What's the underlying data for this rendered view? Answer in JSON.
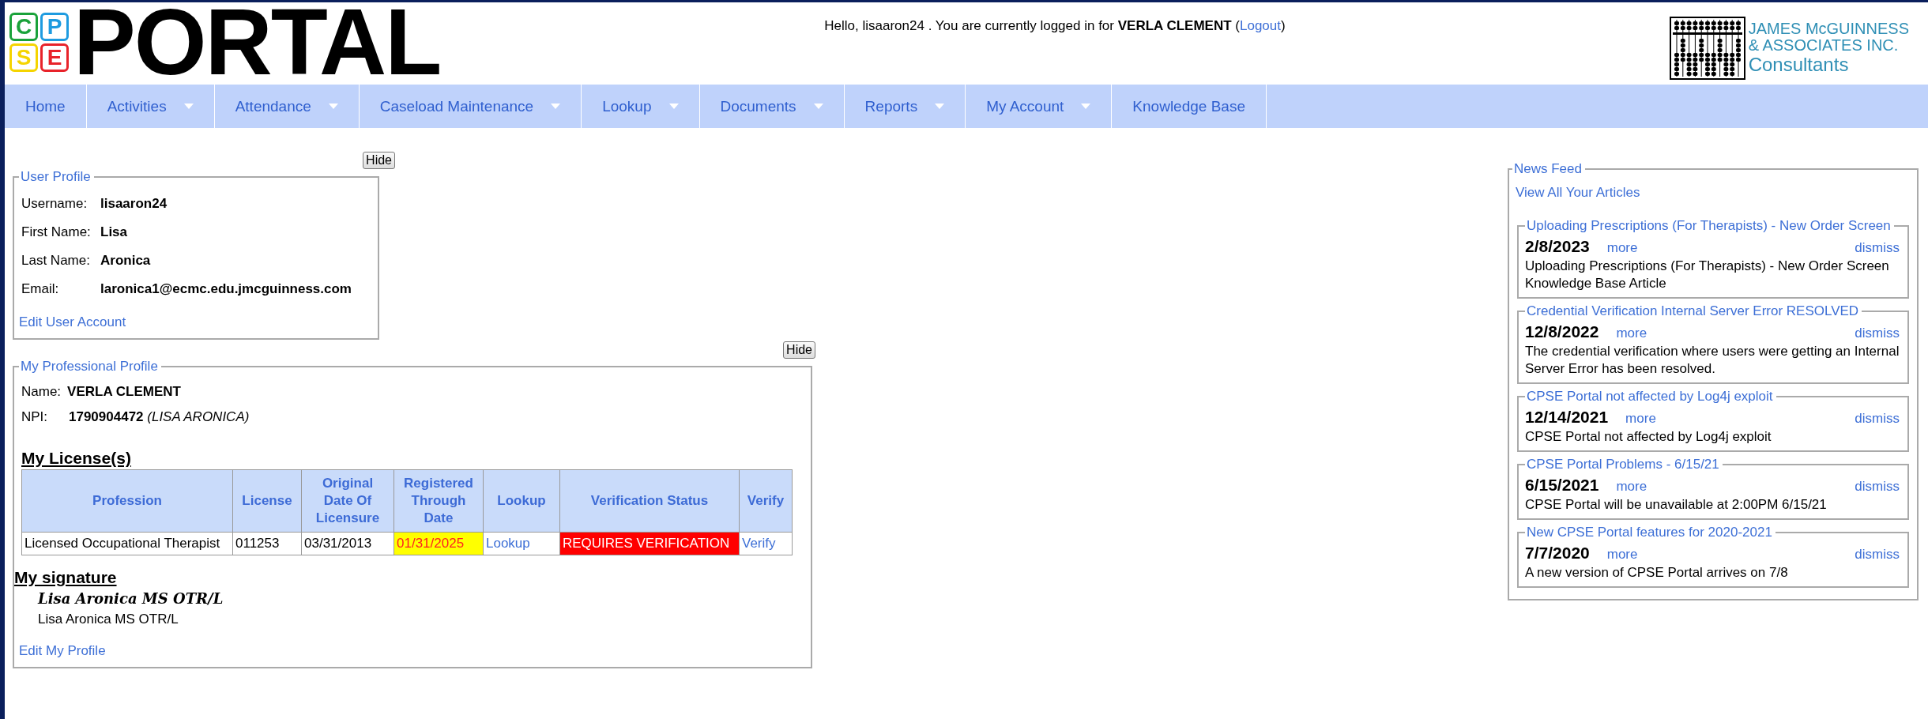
{
  "logo": {
    "letters": [
      {
        "char": "C",
        "color": "#1aa23a"
      },
      {
        "char": "P",
        "color": "#1e9be0"
      },
      {
        "char": "S",
        "color": "#f5d400"
      },
      {
        "char": "E",
        "color": "#e8232a"
      }
    ],
    "title": "PORTAL"
  },
  "header": {
    "greeting": "Hello, lisaaron24 . You are currently logged in for **VERLA CLEMENT** (",
    "logout": "Logout",
    "closing": ")",
    "company": [
      "JAMES McGUINNESS",
      "& ASSOCIATES INC.",
      "Consultants"
    ]
  },
  "nav": [
    {
      "label": "Home",
      "dropdown": false
    },
    {
      "label": "Activities",
      "dropdown": true
    },
    {
      "label": "Attendance",
      "dropdown": true
    },
    {
      "label": "Caseload Maintenance",
      "dropdown": true
    },
    {
      "label": "Lookup",
      "dropdown": true
    },
    {
      "label": "Documents",
      "dropdown": true
    },
    {
      "label": "Reports",
      "dropdown": true
    },
    {
      "label": "My Account",
      "dropdown": true
    },
    {
      "label": "Knowledge Base",
      "dropdown": false
    }
  ],
  "user_profile": {
    "hide": "Hide",
    "legend": "User Profile",
    "fields": [
      {
        "label": "Username:",
        "value": "lisaaron24"
      },
      {
        "label": "First Name:",
        "value": "Lisa"
      },
      {
        "label": "Last Name:",
        "value": "Aronica"
      },
      {
        "label": "Email:",
        "value": "laronica1@ecmc.edu.jmcguinness.com"
      }
    ],
    "edit_link": "Edit User Account"
  },
  "professional_profile": {
    "hide": "Hide",
    "legend": "My Professional Profile",
    "name_label": "Name:",
    "name": "VERLA CLEMENT",
    "npi_label": "NPI:",
    "npi": "1790904472",
    "npi_person": "(LISA ARONICA)",
    "licenses_heading": "My License(s)",
    "table": {
      "columns": [
        "Profession",
        "License",
        "Original Date Of Licensure",
        "Registered Through Date",
        "Lookup",
        "Verification Status",
        "Verify"
      ],
      "rows": [
        [
          {
            "text": "Licensed Occupational Therapist",
            "kind": "text"
          },
          {
            "text": "011253",
            "kind": "text"
          },
          {
            "text": "03/31/2013",
            "kind": "text"
          },
          {
            "text": "01/31/2025",
            "kind": "warning"
          },
          {
            "text": "Lookup",
            "kind": "link"
          },
          {
            "text": "REQUIRES VERIFICATION",
            "kind": "alert"
          },
          {
            "text": "Verify",
            "kind": "link"
          }
        ]
      ]
    },
    "signature_heading": "My signature",
    "signature_script": "Lisa Aronica MS OTR/L",
    "signature_text": "Lisa Aronica MS OTR/L",
    "edit_link": "Edit My Profile"
  },
  "news_feed": {
    "legend": "News Feed",
    "view_all": "View All Your Articles",
    "articles": [
      {
        "title": "Uploading Prescriptions (For Therapists) - New Order Screen",
        "date": "2/8/2023",
        "more": "more",
        "dismiss": "dismiss",
        "body": "Uploading Prescriptions (For Therapists) - New Order Screen Knowledge Base Article"
      },
      {
        "title": "Credential Verification Internal Server Error RESOLVED",
        "date": "12/8/2022",
        "more": "more",
        "dismiss": "dismiss",
        "body": "The credential verification where users were getting an Internal Server Error has been resolved."
      },
      {
        "title": "CPSE Portal not affected by Log4j exploit",
        "date": "12/14/2021",
        "more": "more",
        "dismiss": "dismiss",
        "body": "CPSE Portal not affected by Log4j exploit"
      },
      {
        "title": "CPSE Portal Problems - 6/15/21",
        "date": "6/15/2021",
        "more": "more",
        "dismiss": "dismiss",
        "body": "CPSE Portal will be unavailable at 2:00PM 6/15/21"
      },
      {
        "title": "New CPSE Portal features for 2020-2021",
        "date": "7/7/2020",
        "more": "more",
        "dismiss": "dismiss",
        "body": "A new version of CPSE Portal arrives on 7/8"
      }
    ]
  }
}
